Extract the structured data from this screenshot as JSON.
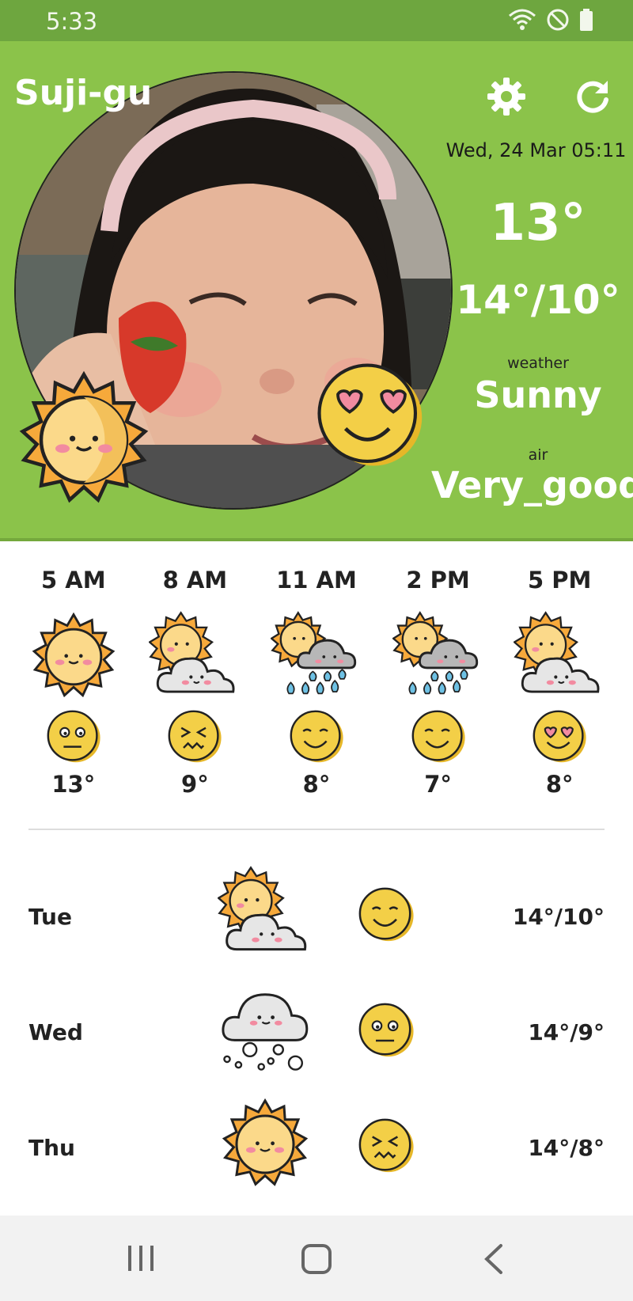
{
  "status": {
    "time": "5:33"
  },
  "header": {
    "location": "Suji-gu",
    "date": "Wed, 24 Mar 05:11",
    "temp": "13°",
    "range": "14°/10°",
    "weather_label": "weather",
    "weather_value": "Sunny",
    "air_label": "air",
    "air_value": "Very_good",
    "photo_icon": "child-photo-with-strawberry",
    "weather_icon": "sun-icon",
    "air_icon": "heart-eyes-face-icon"
  },
  "hourly": [
    {
      "time": "5 AM",
      "icon": "sun-icon",
      "face": "neutral-face-icon",
      "temp": "13°"
    },
    {
      "time": "8 AM",
      "icon": "sun-behind-cloud-icon",
      "face": "squint-face-icon",
      "temp": "9°"
    },
    {
      "time": "11 AM",
      "icon": "sun-cloud-rain-icon",
      "face": "smile-face-icon",
      "temp": "8°"
    },
    {
      "time": "2 PM",
      "icon": "sun-cloud-rain-icon",
      "face": "smile-face-icon",
      "temp": "7°"
    },
    {
      "time": "5 PM",
      "icon": "sun-behind-cloud-icon",
      "face": "heart-eyes-face-icon",
      "temp": "8°"
    }
  ],
  "daily": [
    {
      "day": "Tue",
      "icon": "sun-behind-cloud-icon",
      "face": "smile-face-icon",
      "range": "14°/10°"
    },
    {
      "day": "Wed",
      "icon": "cloud-snow-icon",
      "face": "neutral-face-icon",
      "range": "14°/9°"
    },
    {
      "day": "Thu",
      "icon": "sun-icon",
      "face": "squint-face-icon",
      "range": "14°/8°"
    }
  ],
  "colors": {
    "header": "#8bc34a",
    "statusbar": "#6ea63f",
    "sun": "#f6c15b",
    "face": "#f3cf47"
  }
}
